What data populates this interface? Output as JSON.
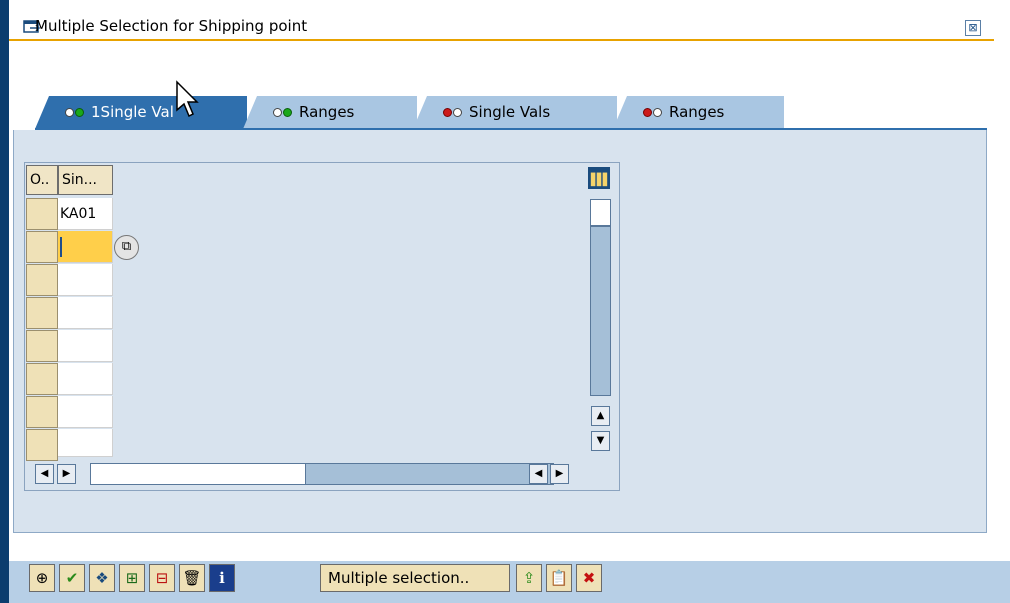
{
  "window": {
    "title": "Multiple Selection for Shipping point",
    "close_glyph": "⊠"
  },
  "tabs": [
    {
      "label": "1Single Val",
      "dot1": "w",
      "dot2": "g",
      "active": true
    },
    {
      "label": "Ranges",
      "dot1": "w",
      "dot2": "g",
      "active": false
    },
    {
      "label": "Single Vals",
      "dot1": "r",
      "dot2": "w",
      "active": false
    },
    {
      "label": "Ranges",
      "dot1": "r",
      "dot2": "w",
      "active": false
    }
  ],
  "grid": {
    "col_option_header": "O..",
    "col_single_header": "Sin...",
    "rows": [
      "KA01",
      "",
      "",
      "",
      "",
      "",
      "",
      ""
    ],
    "f4_glyph": "⧉"
  },
  "scroll": {
    "up": "▲",
    "down": "▼",
    "left": "◀",
    "right": "▶"
  },
  "toolbar": {
    "execute_glyph": "⊕",
    "check_glyph": "✔",
    "import_glyph": "❖",
    "insert_line_glyph": "⊞",
    "delete_line_glyph": "⊟",
    "delete_all_glyph": "🗑",
    "help_glyph": "ℹ",
    "multiple_selection_label": "Multiple selection..",
    "upload_glyph": "⇪",
    "paste_glyph": "📋",
    "cancel_glyph": "✖"
  },
  "colors": {
    "tab_active": "#2f6fad",
    "tab_inactive": "#a9c6e2",
    "panel": "#d8e3ee",
    "active_cell": "#ffcf4a",
    "title_line": "#e8a200"
  }
}
